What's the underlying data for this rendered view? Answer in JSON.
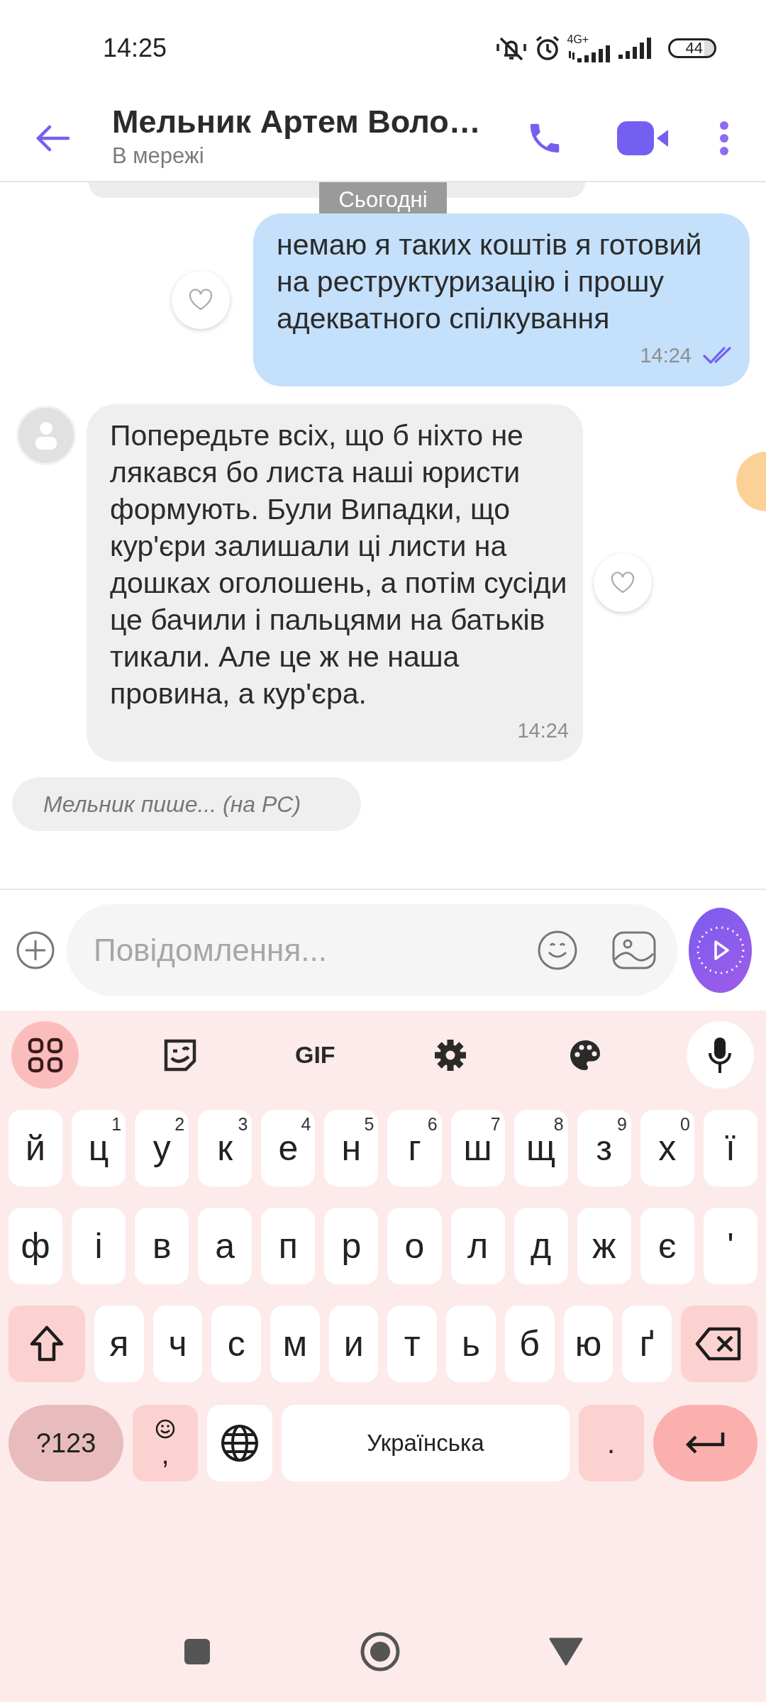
{
  "status_bar": {
    "time": "14:25",
    "network": "4G+",
    "battery": "44"
  },
  "header": {
    "title": "Мельник Артем Воло…",
    "subtitle": "В мережі"
  },
  "messages": [
    {
      "kind": "date",
      "text": "Сьогодні"
    },
    {
      "kind": "outgoing",
      "text": "немаю я таких коштів я готовий на реструктуризацію і прошу адекватного спілкування",
      "time": "14:24",
      "read": true
    },
    {
      "kind": "incoming",
      "text": "Попередьте всіх, що б ніхто не лякався бо листа наші юристи формують. Були Випадки, що кур'єри залишали ці листи на дошках оголошень, а потім сусіди це бачили і пальцями на батьків тикали. Але це ж не наша провина, а кур'єра.",
      "time": "14:24"
    }
  ],
  "typing": "Мельник пише... (на PC)",
  "composer": {
    "placeholder": "Повідомлення..."
  },
  "keyboard": {
    "toolbar": [
      {
        "kind": "apps"
      },
      {
        "kind": "sticker"
      },
      {
        "kind": "gif",
        "label": "GIF"
      },
      {
        "kind": "settings"
      },
      {
        "kind": "palette"
      },
      {
        "kind": "mic"
      }
    ],
    "top_row": [
      {
        "kind": "letter",
        "label": "й"
      },
      {
        "kind": "letter",
        "label": "ц",
        "hint": "1"
      },
      {
        "kind": "letter",
        "label": "у",
        "hint": "2"
      },
      {
        "kind": "letter",
        "label": "к",
        "hint": "3"
      },
      {
        "kind": "letter",
        "label": "е",
        "hint": "4"
      },
      {
        "kind": "letter",
        "label": "н",
        "hint": "5"
      },
      {
        "kind": "letter",
        "label": "г",
        "hint": "6"
      },
      {
        "kind": "letter",
        "label": "ш",
        "hint": "7"
      },
      {
        "kind": "letter",
        "label": "щ",
        "hint": "8"
      },
      {
        "kind": "letter",
        "label": "з",
        "hint": "9"
      },
      {
        "kind": "letter",
        "label": "х",
        "hint": "0"
      },
      {
        "kind": "letter",
        "label": "ї"
      }
    ],
    "middle_row": [
      {
        "kind": "letter",
        "label": "ф"
      },
      {
        "kind": "letter",
        "label": "і"
      },
      {
        "kind": "letter",
        "label": "в"
      },
      {
        "kind": "letter",
        "label": "а"
      },
      {
        "kind": "letter",
        "label": "п"
      },
      {
        "kind": "letter",
        "label": "р"
      },
      {
        "kind": "letter",
        "label": "о"
      },
      {
        "kind": "letter",
        "label": "л"
      },
      {
        "kind": "letter",
        "label": "д"
      },
      {
        "kind": "letter",
        "label": "ж"
      },
      {
        "kind": "letter",
        "label": "є"
      },
      {
        "kind": "letter",
        "label": "'"
      }
    ],
    "lower_row": [
      {
        "kind": "shift"
      },
      {
        "kind": "letter",
        "label": "я"
      },
      {
        "kind": "letter",
        "label": "ч"
      },
      {
        "kind": "letter",
        "label": "с"
      },
      {
        "kind": "letter",
        "label": "м"
      },
      {
        "kind": "letter",
        "label": "и"
      },
      {
        "kind": "letter",
        "label": "т"
      },
      {
        "kind": "letter",
        "label": "ь"
      },
      {
        "kind": "letter",
        "label": "б"
      },
      {
        "kind": "letter",
        "label": "ю"
      },
      {
        "kind": "letter",
        "label": "ґ"
      },
      {
        "kind": "backspace"
      }
    ],
    "bottom_row": [
      {
        "kind": "symbols",
        "label": "?123"
      },
      {
        "kind": "emoji",
        "label": ","
      },
      {
        "kind": "globe"
      },
      {
        "kind": "space",
        "label": "Українська"
      },
      {
        "kind": "period",
        "label": "."
      },
      {
        "kind": "enter"
      }
    ]
  }
}
